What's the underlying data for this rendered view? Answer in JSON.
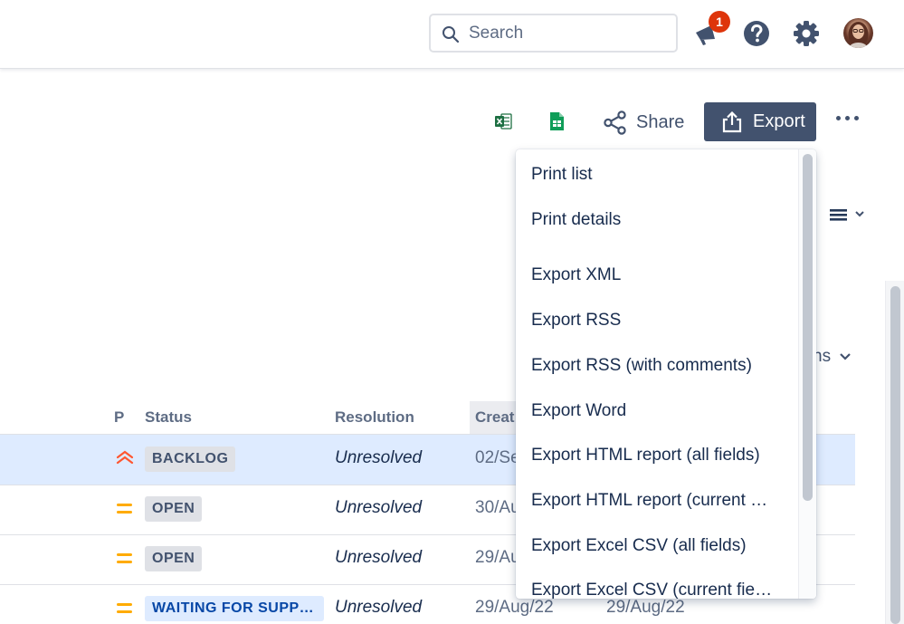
{
  "header": {
    "search_placeholder": "Search",
    "notification_count": "1",
    "icons": [
      "search-icon",
      "megaphone-icon",
      "help-icon",
      "gear-icon",
      "avatar"
    ]
  },
  "toolbar": {
    "share_label": "Share",
    "export_label": "Export",
    "icons": [
      "excel-icon",
      "google-sheets-icon",
      "share-icon",
      "export-icon",
      "more-icon"
    ]
  },
  "columns_label": "ns",
  "table": {
    "headers": {
      "p": "P",
      "status": "Status",
      "resolution": "Resolution",
      "created": "Creat"
    },
    "rows": [
      {
        "priority": "highest",
        "status": "BACKLOG",
        "resolution": "Unresolved",
        "created": "02/Se",
        "updated": ""
      },
      {
        "priority": "medium",
        "status": "OPEN",
        "resolution": "Unresolved",
        "created": "30/Au",
        "updated": ""
      },
      {
        "priority": "medium",
        "status": "OPEN",
        "resolution": "Unresolved",
        "created": "29/Au",
        "updated": ""
      },
      {
        "priority": "medium",
        "status": "WAITING FOR SUPP…",
        "resolution": "Unresolved",
        "created": "29/Aug/22",
        "updated": "29/Aug/22"
      }
    ]
  },
  "export_menu": {
    "items": [
      "Print list",
      "Print details",
      "Export XML",
      "Export RSS",
      "Export RSS (with comments)",
      "Export Word",
      "Export HTML report (all fields)",
      "Export HTML report (current …",
      "Export Excel CSV (all fields)",
      "Export Excel CSV (current fie…"
    ]
  },
  "colors": {
    "primary_button": "#42526e",
    "badge": "#de350b",
    "selected_row": "#deebff",
    "priority_highest": "#ff5630",
    "priority_medium": "#ffab00",
    "excel_green": "#1d6f42",
    "sheets_green": "#0f9d58"
  }
}
